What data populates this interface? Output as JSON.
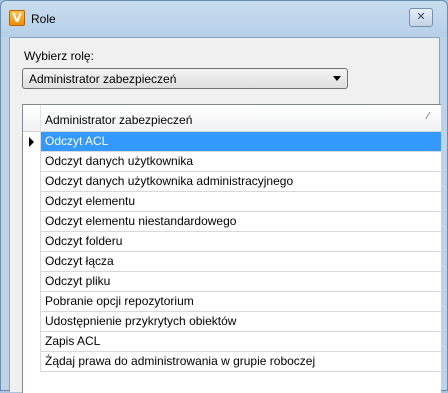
{
  "window": {
    "title": "Role",
    "icon_letter": "V",
    "close_glyph": "✕"
  },
  "role_picker": {
    "label": "Wybierz rolę:",
    "selected": "Administrator zabezpieczeń"
  },
  "grid": {
    "column_header": "Administrator zabezpieczeń",
    "sort_glyph": "⁄",
    "rows": [
      "Odczyt ACL",
      "Odczyt danych użytkownika",
      "Odczyt danych użytkownika administracyjnego",
      "Odczyt elementu",
      "Odczyt elementu niestandardowego",
      "Odczyt folderu",
      "Odczyt łącza",
      "Odczyt pliku",
      "Pobranie opcji repozytorium",
      "Udostępnienie przykrytych obiektów",
      "Zapis ACL",
      "Żądaj prawa do administrowania w grupie roboczej"
    ],
    "selected_index": 0
  }
}
